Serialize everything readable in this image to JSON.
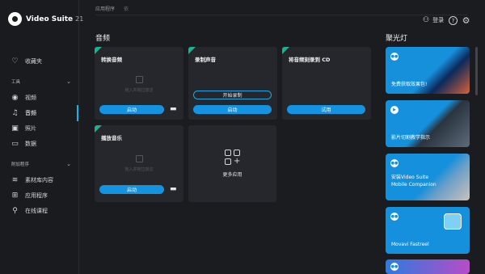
{
  "app": {
    "title": "Video Suite",
    "version": "21"
  },
  "sidebar": {
    "favorites_label": "收藏夹",
    "tools_section": "工具",
    "tools": [
      {
        "label": "视频",
        "icon": "video-icon"
      },
      {
        "label": "音频",
        "icon": "music-note-icon"
      },
      {
        "label": "照片",
        "icon": "camera-icon"
      },
      {
        "label": "数据",
        "icon": "folder-icon"
      }
    ],
    "addons_section": "附加程序",
    "addons": [
      {
        "label": "素材库内容",
        "icon": "layers-icon"
      },
      {
        "label": "应用程序",
        "icon": "apps-icon"
      },
      {
        "label": "在线课程",
        "icon": "pin-icon"
      }
    ]
  },
  "topbar": {
    "crumb": "应用程序",
    "crumb2": "依",
    "login_label": "登录"
  },
  "main": {
    "heading": "音频",
    "cards": [
      {
        "title": "转换音频",
        "drop_text": "拖入并拖拉放这",
        "button": "启动"
      },
      {
        "title": "录制声音",
        "outline_button": "开始录制",
        "button": "启动"
      },
      {
        "title": "将音频刻录到 CD",
        "button": "试用"
      },
      {
        "title": "播放音乐",
        "drop_text": "拖入并拖拉放这",
        "button": "启动"
      }
    ],
    "more_label": "更多应用"
  },
  "spotlight": {
    "heading": "聚光灯",
    "items": [
      {
        "text": "免费获取效果包!",
        "icon": "chat-icon"
      },
      {
        "text": "影片切割教学指示",
        "icon": "play-icon"
      },
      {
        "text": "安装Video Suite Mobile Companion",
        "icon": "chat-icon"
      },
      {
        "text": "Movavi Fastreel",
        "icon": "chat-icon"
      },
      {
        "text": "",
        "icon": "chat-icon"
      }
    ]
  },
  "colors": {
    "accent": "#1493e0",
    "corner": "#1eb08f",
    "background": "#1b1c20",
    "card": "#26272c"
  }
}
